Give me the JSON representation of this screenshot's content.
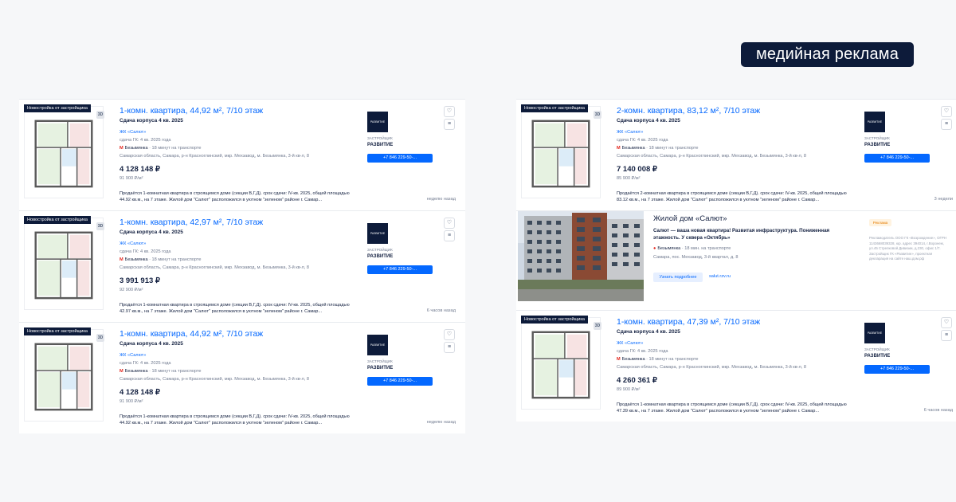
{
  "media_badge": "медийная реклама",
  "listings": [
    {
      "tag": "Новостройка от застройщика",
      "badge": "3D",
      "title": "1-комн. квартира, 44,92 м², 7/10 этаж",
      "delivery": "Сдача корпуса 4 кв. 2025",
      "complex": "ЖК «Салют»",
      "gk": "сдача ГК: 4 кв. 2025 года",
      "metro_station": "Безымянка",
      "metro_time": "· 18 минут на транспорте",
      "address": "Самарская область, Самара, р-н Красноглинский, мкр. Мехзавод, м. Безымянка, 3-й кв-л, 8",
      "price": "4 128 148 ₽",
      "price_per_m": "91 900 ₽/м²",
      "description": "Продаётся 1-комнатная квартира в строящемся доме (секции В,Г,Д). срок сдачи: IV-кв. 2025, общей площадью 44.92 кв.м., на 7 этаже. Жилой дом \"Салют\" расположился в уютном \"зеленом\" районе г. Самар...",
      "time": "неделю назад",
      "developer_logo": "РАЗВИТИЕ",
      "developer_role": "ЗАСТРОЙЩИК",
      "developer_name": "РАЗВИТИЕ",
      "phone": "+7 846 229-50-..."
    },
    {
      "tag": "Новостройка от застройщика",
      "badge": "3D",
      "title": "1-комн. квартира, 42,97 м², 7/10 этаж",
      "delivery": "Сдача корпуса 4 кв. 2025",
      "complex": "ЖК «Салют»",
      "gk": "сдача ГК: 4 кв. 2025 года",
      "metro_station": "Безымянка",
      "metro_time": "· 18 минут на транспорте",
      "address": "Самарская область, Самара, р-н Красноглинский, мкр. Мехзавод, м. Безымянка, 3-й кв-л, 8",
      "price": "3 991 913 ₽",
      "price_per_m": "92 900 ₽/м²",
      "description": "Продаётся 1-комнатная квартира в строящемся доме (секции В,Г,Д). срок сдачи: IV-кв. 2025, общей площадью 42.97 кв.м., на 7 этаже. Жилой дом \"Салют\" расположился в уютном \"зеленом\" районе г. Самар...",
      "time": "6 часов назад",
      "developer_logo": "РАЗВИТИЕ",
      "developer_role": "ЗАСТРОЙЩИК",
      "developer_name": "РАЗВИТИЕ",
      "phone": "+7 846 229-50-..."
    },
    {
      "tag": "Новостройка от застройщика",
      "badge": "3D",
      "title": "1-комн. квартира, 44,92 м², 7/10 этаж",
      "delivery": "Сдача корпуса 4 кв. 2025",
      "complex": "ЖК «Салют»",
      "gk": "сдача ГК: 4 кв. 2025 года",
      "metro_station": "Безымянка",
      "metro_time": "· 18 минут на транспорте",
      "address": "Самарская область, Самара, р-н Красноглинский, мкр. Мехзавод, м. Безымянка, 3-й кв-л, 8",
      "price": "4 128 148 ₽",
      "price_per_m": "91 900 ₽/м²",
      "description": "Продаётся 1-комнатная квартира в строящемся доме (секции В,Г,Д). срок сдачи: IV-кв. 2025, общей площадью 44.92 кв.м., на 7 этаже. Жилой дом \"Салют\" расположился в уютном \"зеленом\" районе г. Самар...",
      "time": "неделю назад",
      "developer_logo": "РАЗВИТИЕ",
      "developer_role": "ЗАСТРОЙЩИК",
      "developer_name": "РАЗВИТИЕ",
      "phone": "+7 846 229-50-..."
    },
    {
      "tag": "Новостройка от застройщика",
      "badge": "3D",
      "title": "2-комн. квартира, 83,12 м², 7/10 этаж",
      "delivery": "Сдача корпуса 4 кв. 2025",
      "complex": "ЖК «Салют»",
      "gk": "сдача ГК: 4 кв. 2025 года",
      "metro_station": "Безымянка",
      "metro_time": "· 18 минут на транспорте",
      "address": "Самарская область, Самара, р-н Красноглинский, мкр. Мехзавод, м. Безымянка, 3-й кв-л, 8",
      "price": "7 140 008 ₽",
      "price_per_m": "85 900 ₽/м²",
      "description": "Продаётся 2-комнатная квартира в строящемся доме (секции В,Г,Д). срок сдачи: IV-кв. 2025, общей площадью 83.12 кв.м., на 7 этаже. Жилой дом \"Салют\" расположился в уютном \"зеленом\" районе г. Самар...",
      "time": "3 недели",
      "developer_logo": "РАЗВИТИЕ",
      "developer_role": "ЗАСТРОЙЩИК",
      "developer_name": "РАЗВИТИЕ",
      "phone": "+7 846 229-50-..."
    },
    {
      "tag": "Новостройка от застройщика",
      "badge": "3D",
      "title": "1-комн. квартира, 47,39 м², 7/10 этаж",
      "delivery": "Сдача корпуса 4 кв. 2025",
      "complex": "ЖК «Салют»",
      "gk": "сдача ГК: 4 кв. 2025 года",
      "metro_station": "Безымянка",
      "metro_time": "· 18 минут на транспорте",
      "address": "Самарская область, Самара, р-н Красноглинский, мкр. Мехзавод, м. Безымянка, 3-й кв-л, 8",
      "price": "4 260 361 ₽",
      "price_per_m": "89 900 ₽/м²",
      "description": "Продаётся 1-комнатная квартира в строящемся доме (секции В,Г,Д). срок сдачи: IV-кв. 2025, общей площадью 47.39 кв.м., на 7 этаже. Жилой дом \"Салют\" расположился в уютном \"зеленом\" районе г. Самар...",
      "time": "6 часов назад",
      "developer_logo": "РАЗВИТИЕ",
      "developer_role": "ЗАСТРОЙЩИК",
      "developer_name": "РАЗВИТИЕ",
      "phone": "+7 846 229-50-..."
    }
  ],
  "ad": {
    "title": "Жилой дом «Салют»",
    "description": "Салют — ваша новая квартира! Развитая инфраструктура. Пониженная этажность. У сквера «Октябрь»",
    "metro": "Безымянка",
    "metro_time": "· 18 мин. на транспорте",
    "address": "Самара, пос. Мехзавод, 3-й квартал, д. 8",
    "button": "Узнать подробнее",
    "site": "salut.rzv.ru",
    "label": "Реклама",
    "legal": "Рекламодатель ООО ГК «Возрождение», ОГРН 1143668039328, юр. адрес 394014, г.Воронеж, ул.45 Стрелковой Дивизии, д.230, офис 1/7. Застройщик ГК «Развитие», проектная декларация на сайте наш.дом.рф"
  },
  "colors": {
    "accent": "#0468ff",
    "navy": "#0d1b3a",
    "metro": "#e2231a"
  }
}
